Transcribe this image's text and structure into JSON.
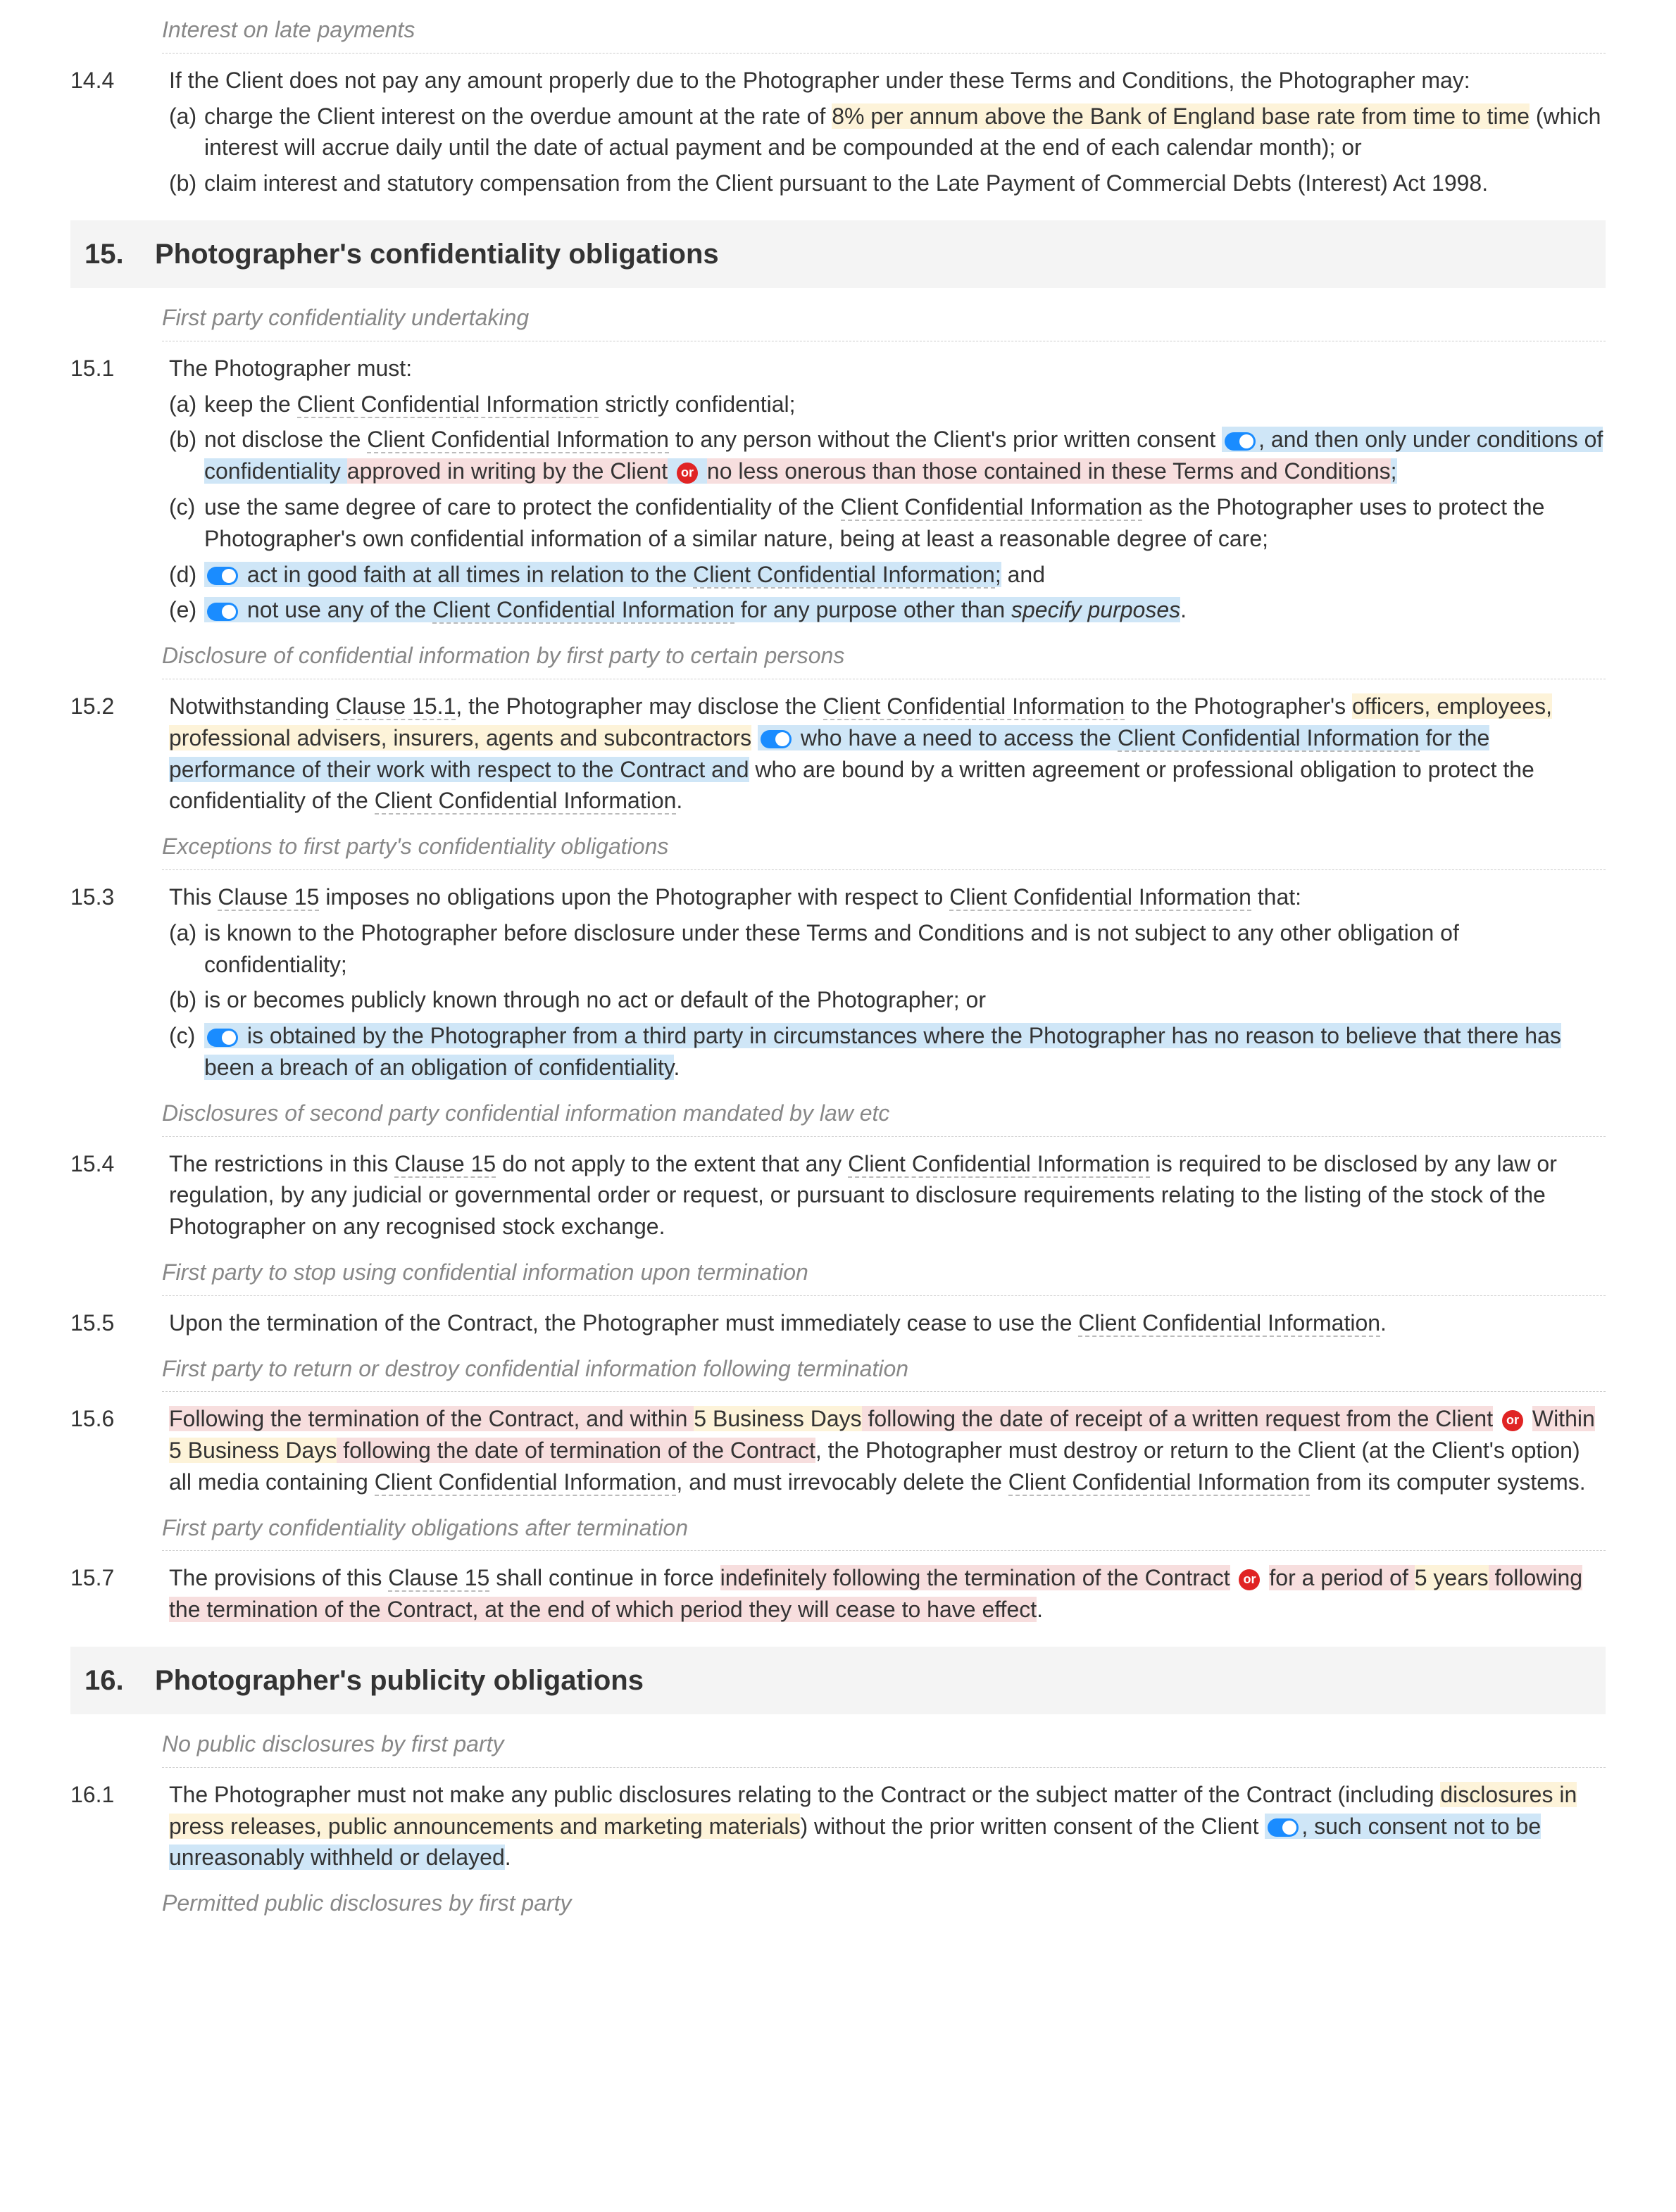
{
  "subheadings": {
    "interest_late": "Interest on late payments",
    "first_party_conf": "First party confidentiality undertaking",
    "disclosure_certain": "Disclosure of confidential information by first party to certain persons",
    "exceptions": "Exceptions to first party's confidentiality obligations",
    "mandated_law": "Disclosures of second party confidential information mandated by law etc",
    "stop_using": "First party to stop using confidential information upon termination",
    "return_destroy": "First party to return or destroy confidential information following termination",
    "after_termination": "First party confidentiality obligations after termination",
    "no_public": "No public disclosures by first party",
    "permitted_public": "Permitted public disclosures by first party"
  },
  "clause_14_4": {
    "num": "14.4",
    "lead": "If the Client does not pay any amount properly due to the Photographer under these Terms and Conditions, the Photographer may:",
    "a_label": "(a)",
    "a_pre": "charge the Client interest on the overdue amount at the rate of ",
    "a_hl": "8% per annum above the Bank of England base rate from time to time",
    "a_post": " (which interest will accrue daily until the date of actual payment and be compounded at the end of each calendar month); or",
    "b_label": "(b)",
    "b_text": "claim interest and statutory compensation from the Client pursuant to the Late Payment of Commercial Debts (Interest) Act 1998."
  },
  "section_15": {
    "num": "15.",
    "title": "Photographer's confidentiality obligations"
  },
  "clause_15_1": {
    "num": "15.1",
    "lead": "The Photographer must:",
    "a_label": "(a)",
    "a_pre": "keep the ",
    "a_dot": "Client Confidential Information",
    "a_post": " strictly confidential;",
    "b_label": "(b)",
    "b_pre": "not disclose the ",
    "b_dot": "Client Confidential Information",
    "b_mid": " to any person without the Client's prior written consent ",
    "b_hl1": ", and then only under conditions of confidentiality ",
    "b_hl2a": "approved in writing by the Client",
    "b_hl2b": " no less onerous than those contained in these Terms and Conditions",
    "b_end": ";",
    "c_label": "(c)",
    "c_pre": "use the same degree of care to protect the confidentiality of the ",
    "c_dot": "Client Confidential Information",
    "c_post": " as the Photographer uses to protect the Photographer's own confidential information of a similar nature, being at least a reasonable degree of care;",
    "d_label": "(d)",
    "d_hl_pre": " act in good faith at all times in relation to the ",
    "d_dot": "Client Confidential Information",
    "d_hl_post": ";",
    "d_end": " and",
    "e_label": "(e)",
    "e_hl_pre": " not use any of the ",
    "e_dot": "Client Confidential Information",
    "e_hl_post": " for any purpose other than ",
    "e_italic": "specify purposes",
    "e_end": "."
  },
  "clause_15_2": {
    "num": "15.2",
    "pre": "Notwithstanding ",
    "link": "Clause 15.1",
    "mid1": ", the Photographer may disclose the ",
    "dot1": "Client Confidential Information",
    "mid2": " to the Photographer's ",
    "hl1": "officers, employees, professional advisers, insurers, agents and subcontractors",
    "hl2_pre": " who have a need to access the ",
    "hl2_dot": "Client Confidential Information",
    "hl2_post": " for the performance of their work with respect to the Contract and",
    "post1": " who are bound by a written agreement or professional obligation to protect the confidentiality of the ",
    "dot2": "Client Confidential Information",
    "end": "."
  },
  "clause_15_3": {
    "num": "15.3",
    "lead_pre": "This ",
    "lead_link": "Clause 15",
    "lead_mid": " imposes no obligations upon the Photographer with respect to ",
    "lead_dot": "Client Confidential Information",
    "lead_post": " that:",
    "a_label": "(a)",
    "a_text": "is known to the Photographer before disclosure under these Terms and Conditions and is not subject to any other obligation of confidentiality;",
    "b_label": "(b)",
    "b_text": "is or becomes publicly known through no act or default of the Photographer; or",
    "c_label": "(c)",
    "c_hl": " is obtained by the Photographer from a third party in circumstances where the Photographer has no reason to believe that there has been a breach of an obligation of confidentiality",
    "c_end": "."
  },
  "clause_15_4": {
    "num": "15.4",
    "pre": "The restrictions in this ",
    "link": "Clause 15",
    "mid": " do not apply to the extent that any ",
    "dot": "Client Confidential Information",
    "post": " is required to be disclosed by any law or regulation, by any judicial or governmental order or request, or pursuant to disclosure requirements relating to the listing of the stock of the Photographer on any recognised stock exchange."
  },
  "clause_15_5": {
    "num": "15.5",
    "pre": "Upon the termination of the Contract, the Photographer must immediately cease to use the ",
    "dot": "Client Confidential Information",
    "end": "."
  },
  "clause_15_6": {
    "num": "15.6",
    "pink1_pre": "Following the termination of the Contract, and within ",
    "pink1_yel": "5 Business Days",
    "pink1_post": " following the date of receipt of a written request from the Client",
    "pink2_pre": " Within ",
    "pink2_yel": "5 Business Days",
    "pink2_post": " following the date of termination of the Contract",
    "mid1": ", the Photographer must destroy or return to the Client (at the Client's option) all media containing ",
    "dot1": "Client Confidential Information",
    "mid2": ", and must irrevocably delete the ",
    "dot2": "Client Confidential Information",
    "end": " from its computer systems."
  },
  "clause_15_7": {
    "num": "15.7",
    "pre": "The provisions of this ",
    "link": "Clause 15",
    "mid": " shall continue in force ",
    "pink1": "indefinitely following the termination of the Contract",
    "pink2_pre": " for a period of ",
    "pink2_yel": "5 years",
    "pink2_post": " following the termination of the Contract, at the end of which period they will cease to have effect",
    "end": "."
  },
  "section_16": {
    "num": "16.",
    "title": "Photographer's publicity obligations"
  },
  "clause_16_1": {
    "num": "16.1",
    "pre": "The Photographer must not make any public disclosures relating to the Contract or the subject matter of the Contract (including ",
    "yel": "disclosures in press releases, public announcements and marketing materials",
    "mid": ") without the prior written consent of the Client ",
    "blue": ", such consent not to be unreasonably withheld or delayed",
    "end": "."
  },
  "or_label": "or"
}
